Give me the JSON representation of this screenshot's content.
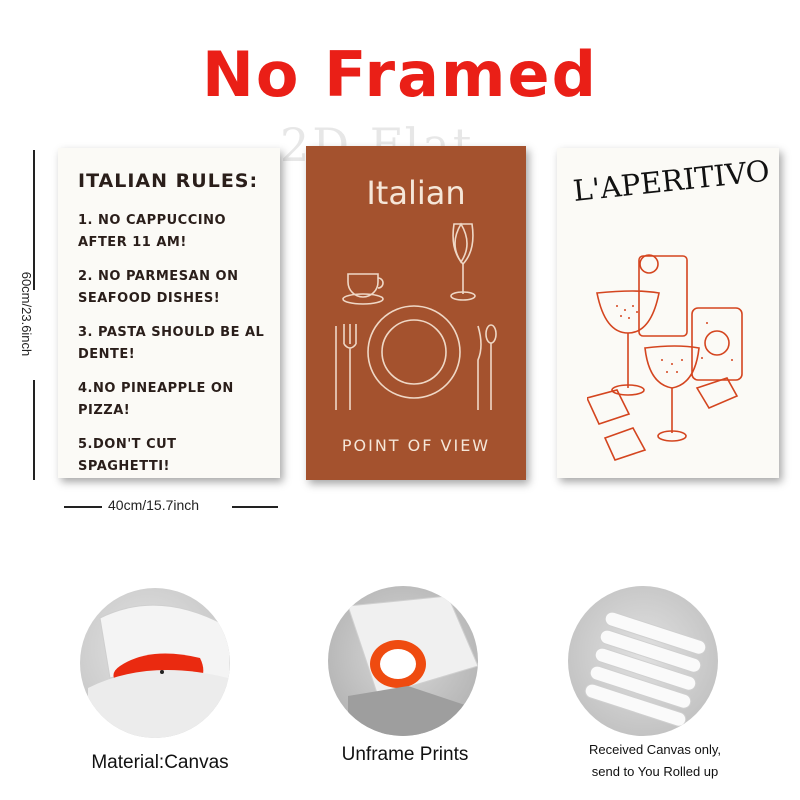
{
  "headline": "No Framed",
  "watermark": "2D Flat",
  "posters": {
    "rules": {
      "title": "ITALIAN RULES:",
      "items": [
        "1. NO CAPPUCCINO AFTER 11 AM!",
        "2. NO PARMESAN ON SEAFOOD DISHES!",
        "3. PASTA SHOULD BE AL DENTE!",
        "4.NO PINEAPPLE ON PIZZA!",
        "5.DON'T CUT SPAGHETTI!"
      ]
    },
    "italian": {
      "title": "Italian",
      "subtitle": "POINT OF VIEW"
    },
    "aperitivo": {
      "title": "L'APERITIVO"
    }
  },
  "dimensions": {
    "width": "40cm/15.7inch",
    "height": "60cm/23.6inch"
  },
  "features": {
    "material": "Material:Canvas",
    "unframe": "Unframe  Prints",
    "received_line1": "Received Canvas only,",
    "received_line2": "send to You Rolled up"
  },
  "colors": {
    "headline": "#ea1f17",
    "terracotta": "#a4522e",
    "illustration": "#d4451f"
  }
}
